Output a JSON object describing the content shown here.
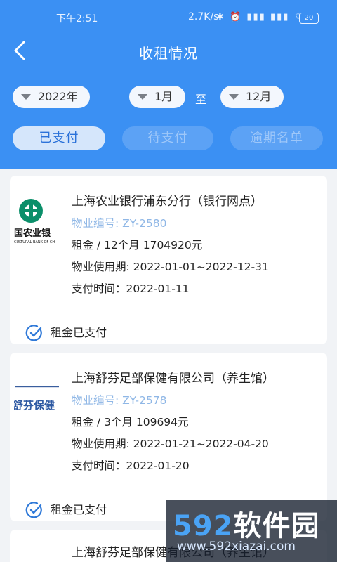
{
  "status_bar": {
    "time": "下午2:51",
    "speed": "2.7K/s",
    "icons": "✱ ⏰ ▮▮▮ ▮▮▮ ⌔",
    "battery": "20"
  },
  "header": {
    "title": "收租情况"
  },
  "filters": {
    "year": "2022年",
    "from_month": "1月",
    "to_label": "至",
    "to_month": "12月"
  },
  "tabs": [
    {
      "label": "已支付",
      "active": true
    },
    {
      "label": "待支付",
      "active": false
    },
    {
      "label": "逾期名单",
      "active": false
    }
  ],
  "cards": [
    {
      "name": "上海农业银行浦东分行（银行网点）",
      "code": "物业编号: ZY-2580",
      "rent": "租金 / 12个月 1704920元",
      "period": "物业使用期: 2022-01-01~2022-12-31",
      "pay_time": "支付时间：2022-01-11",
      "status": "租金已支付",
      "logo_text": "国农业银",
      "logo_sub": "CULTURAL BANK OF CH"
    },
    {
      "name": "上海舒芬足部保健有限公司（养生馆）",
      "code": "物业编号: ZY-2578",
      "rent": "租金 / 3个月 109694元",
      "period": "物业使用期: 2022-01-21~2022-04-20",
      "pay_time": "支付时间：2022-01-20",
      "status": "租金已支付",
      "logo_text": "舒芬保健"
    },
    {
      "name": "上海舒芬足部保健有限公司（养生馆）"
    }
  ],
  "watermark": {
    "brand_num": "592",
    "brand_cn": "软件园",
    "url": "www.592xiazai.com"
  }
}
